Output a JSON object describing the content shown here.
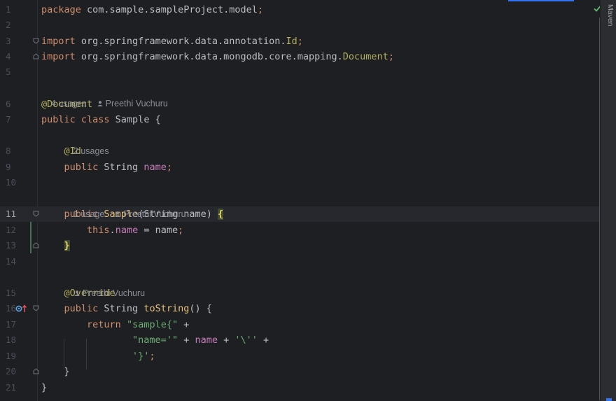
{
  "editor": {
    "lines": [
      {
        "n": "1",
        "segments": [
          {
            "t": "package",
            "c": "kw"
          },
          {
            "t": " com.sample.sampleProject.model",
            "c": "cls"
          },
          {
            "t": ";",
            "c": "kw"
          }
        ]
      },
      {
        "n": "2",
        "segments": []
      },
      {
        "n": "3",
        "segments": [
          {
            "t": "import",
            "c": "kw"
          },
          {
            "t": " org.springframework.data.annotation.",
            "c": "cls"
          },
          {
            "t": "Id",
            "c": "ann"
          },
          {
            "t": ";",
            "c": "kw"
          }
        ]
      },
      {
        "n": "4",
        "segments": [
          {
            "t": "import",
            "c": "kw"
          },
          {
            "t": " org.springframework.data.mongodb.core.mapping.",
            "c": "cls"
          },
          {
            "t": "Document",
            "c": "ann"
          },
          {
            "t": ";",
            "c": "kw"
          }
        ]
      },
      {
        "n": "5",
        "segments": []
      },
      {
        "n": "6",
        "segments": [
          {
            "t": "@Document",
            "c": "ann"
          }
        ]
      },
      {
        "n": "7",
        "segments": [
          {
            "t": "public class",
            "c": "kw"
          },
          {
            "t": " Sample {",
            "c": "cls"
          }
        ]
      },
      {
        "n": "8",
        "segments": [
          {
            "t": "    @Id",
            "c": "ann"
          }
        ]
      },
      {
        "n": "9",
        "segments": [
          {
            "t": "    public",
            "c": "kw"
          },
          {
            "t": " String ",
            "c": "cls"
          },
          {
            "t": "name",
            "c": "field"
          },
          {
            "t": ";",
            "c": "kw"
          }
        ]
      },
      {
        "n": "10",
        "segments": []
      },
      {
        "n": "11",
        "segments": [
          {
            "t": "    public",
            "c": "kw"
          },
          {
            "t": " ",
            "c": "cls"
          },
          {
            "t": "Sample",
            "c": "decl"
          },
          {
            "t": "(String name) ",
            "c": "cls"
          },
          {
            "t": "{",
            "c": "brace"
          }
        ]
      },
      {
        "n": "12",
        "segments": [
          {
            "t": "        this",
            "c": "kw"
          },
          {
            "t": ".",
            "c": "cls"
          },
          {
            "t": "name",
            "c": "field"
          },
          {
            "t": " = name",
            "c": "cls"
          },
          {
            "t": ";",
            "c": "kw"
          }
        ]
      },
      {
        "n": "13",
        "segments": [
          {
            "t": "    ",
            "c": "cls"
          },
          {
            "t": "}",
            "c": "brace"
          }
        ]
      },
      {
        "n": "14",
        "segments": []
      },
      {
        "n": "15",
        "segments": [
          {
            "t": "    @Override",
            "c": "ann"
          }
        ]
      },
      {
        "n": "16",
        "segments": [
          {
            "t": "    public",
            "c": "kw"
          },
          {
            "t": " String ",
            "c": "cls"
          },
          {
            "t": "toString",
            "c": "decl"
          },
          {
            "t": "() {",
            "c": "cls"
          }
        ]
      },
      {
        "n": "17",
        "segments": [
          {
            "t": "        return",
            "c": "kw"
          },
          {
            "t": " ",
            "c": "cls"
          },
          {
            "t": "\"sample{\"",
            "c": "str"
          },
          {
            "t": " +",
            "c": "cls"
          }
        ]
      },
      {
        "n": "18",
        "segments": [
          {
            "t": "                ",
            "c": "cls"
          },
          {
            "t": "\"name='\"",
            "c": "str"
          },
          {
            "t": " + ",
            "c": "cls"
          },
          {
            "t": "name",
            "c": "field"
          },
          {
            "t": " + ",
            "c": "cls"
          },
          {
            "t": "'\\''",
            "c": "str"
          },
          {
            "t": " +",
            "c": "cls"
          }
        ]
      },
      {
        "n": "19",
        "segments": [
          {
            "t": "                ",
            "c": "cls"
          },
          {
            "t": "'}'",
            "c": "str"
          },
          {
            "t": ";",
            "c": "kw"
          }
        ]
      },
      {
        "n": "20",
        "segments": [
          {
            "t": "    }",
            "c": "cls"
          }
        ]
      },
      {
        "n": "21",
        "segments": [
          {
            "t": "}",
            "c": "cls"
          }
        ]
      }
    ],
    "hints": {
      "class_usages": "4 usages",
      "class_author": "Preethi Vuchuru",
      "field_usages": "2 usages",
      "ctor_usages": "1 usage",
      "ctor_author": "Preethi Vuchuru",
      "method_author": "Preethi Vuchuru"
    },
    "active_line": "11"
  },
  "tool_window": {
    "maven_label": "Maven"
  },
  "colors": {
    "background": "#1e1f22",
    "keyword": "#cf8e6d",
    "annotation": "#b3ae60",
    "field": "#c77dbb",
    "string": "#6aab73",
    "declaration": "#e5c07b",
    "accent": "#3574f0"
  },
  "icons": {
    "inspection_ok": "check-icon",
    "override_marker": "override-icon",
    "author": "person-icon",
    "fold": "fold-icon"
  }
}
